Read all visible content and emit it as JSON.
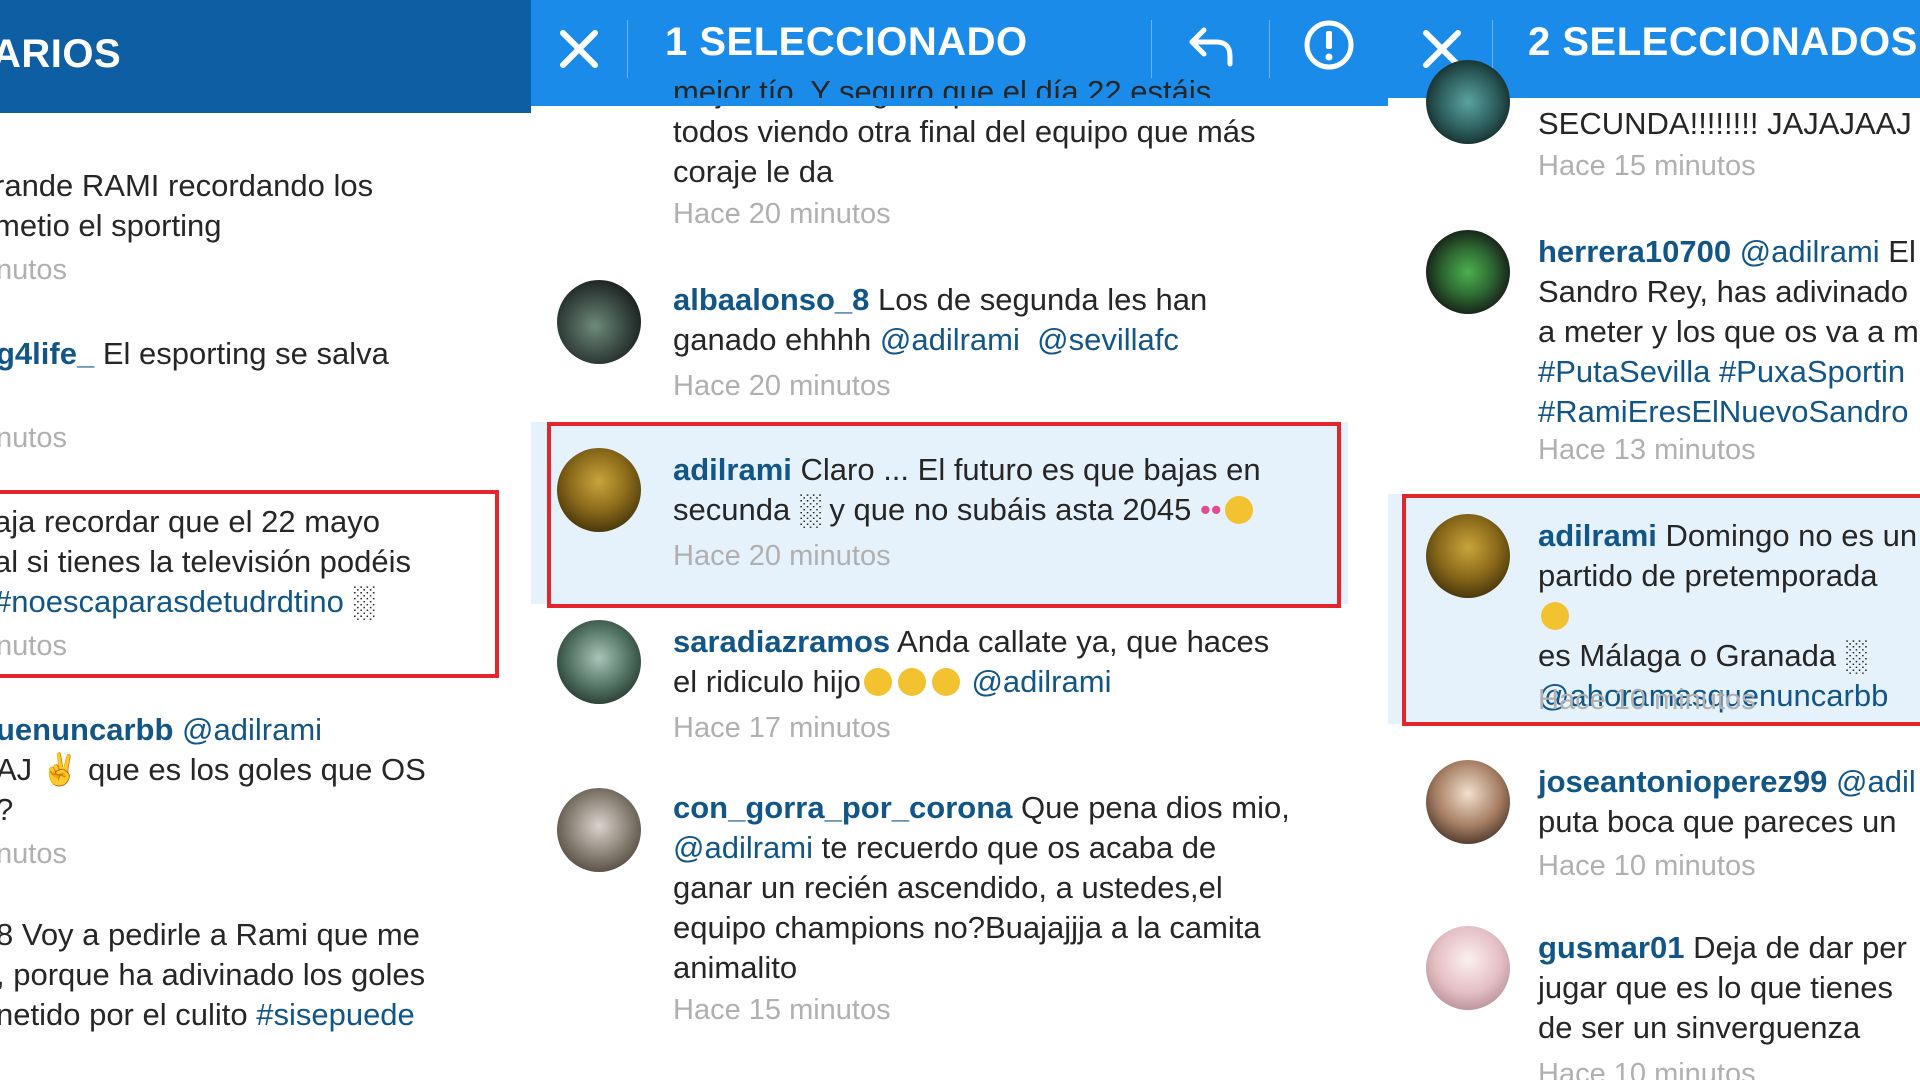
{
  "colors": {
    "left_header": "#0e5ea3",
    "action_bar": "#1a8be8",
    "username": "#125688",
    "timestamp": "#b0b0b0",
    "selected_bg": "#e5f1fb",
    "highlight_border": "#e2262b"
  },
  "left": {
    "header_title": "ARIOS",
    "comments": [
      {
        "line1": "rande RAMI recordando los",
        "line2": "metio el sporting",
        "time": "nutos"
      },
      {
        "user": "g4life_",
        "line1_rest": " El esporting se salva",
        "time": "nutos"
      },
      {
        "line1": "aja recordar que el 22 mayo",
        "line2": "al si tienes la televisión podéis",
        "tag": "#noescaparasdetudrdtino",
        "tag_rest": " ░",
        "time": "nutos"
      },
      {
        "user": "uenuncarbb",
        "mention": "@adilrami",
        "line2": "AJ ✌ que es los goles que OS",
        "line3": "?",
        "time": "nutos"
      },
      {
        "line1": "8 Voy a pedirle a Rami que me",
        "line2": ", porque ha adivinado los goles",
        "line3_pre": "netido por el culito ",
        "tag": "#sisepuede"
      }
    ]
  },
  "middle": {
    "title": "1 SELECCIONADO",
    "icons": [
      "close-icon",
      "reply-icon",
      "report-icon"
    ],
    "comments": [
      {
        "line0": "mejor tío. Y seguro que el día 22 estáis",
        "line1": "todos viendo otra final del equipo que más",
        "line2": "coraje le da",
        "time": "Hace 20 minutos"
      },
      {
        "user": "albaalonso_8",
        "text": " Los de segunda les han",
        "line2_pre": "ganado ehhhh ",
        "mention1": "@adilrami",
        "mention2": "@sevillafc",
        "time": "Hace 20 minutos"
      },
      {
        "user": "adilrami",
        "text": " Claro ... El futuro es que bajas en",
        "line2": "secunda ░ y que no subáis asta 2045 ",
        "time": "Hace 20 minutos"
      },
      {
        "user": "saradiazramos",
        "text": " Anda callate ya, que haces",
        "line2_pre": "el ridiculo hijo",
        "mention": "@adilrami",
        "time": "Hace 17 minutos"
      },
      {
        "user": "con_gorra_por_corona",
        "text": " Que pena dios mio,",
        "mention": "@adilrami",
        "line2_rest": " te recuerdo que os acaba de",
        "line3": "ganar un recién ascendido, a ustedes,el",
        "line4": "equipo champions no?Buajajjja a la camita",
        "line5": "animalito",
        "time": "Hace 15 minutos"
      }
    ]
  },
  "right": {
    "title": "2 SELECCIONADOS",
    "comments": [
      {
        "line1": "SECUNDA!!!!!!!! JAJAJAAJ",
        "time": "Hace 15 minutos"
      },
      {
        "user": "herrera10700",
        "mention": " @adilrami",
        "rest": " El",
        "line2": "Sandro Rey, has adivinado",
        "line3": "a meter y los que os va a m",
        "tags4": "#PutaSevilla #PuxaSportin",
        "tags5": "#RamiEresElNuevoSandro",
        "time": "Hace 13 minutos"
      },
      {
        "user": "adilrami",
        "text": " Domingo no es un",
        "line2": "partido de pretemporada ",
        "line3": "es Málaga o Granada ░",
        "mention": "@ahoramasquenuncarbb",
        "time": "Hace 10 minutos"
      },
      {
        "user": "joseantonioperez99",
        "mention": " @adil",
        "line2": "puta boca que pareces un",
        "time": "Hace 10 minutos"
      },
      {
        "user": "gusmar01",
        "text": " Deja de dar per",
        "line2": "jugar que es lo que tienes",
        "line3": "de ser un sinverguenza",
        "time": "Hace 10 minutos"
      }
    ]
  }
}
